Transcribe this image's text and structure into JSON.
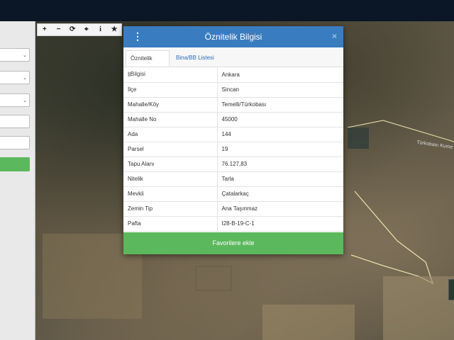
{
  "map": {
    "road_label": "Türkobası Kume Ev"
  },
  "toolbar": {
    "icons": [
      "plus-icon",
      "minus-icon",
      "refresh-icon",
      "crosshair-icon",
      "info-icon",
      "star-icon"
    ]
  },
  "modal": {
    "title": "Öznitelik Bilgisi",
    "close_label": "×",
    "menu_icon": "⋮",
    "tabs": [
      {
        "label": "Öznitelik Bilgisi",
        "active": true
      },
      {
        "label": "Bina/BB Listesi",
        "active": false
      }
    ],
    "rows": [
      {
        "key": "İl",
        "value": "Ankara"
      },
      {
        "key": "İlçe",
        "value": "Sincan"
      },
      {
        "key": "Mahalle/Köy",
        "value": "Temelli/Türkobası"
      },
      {
        "key": "Mahalle No",
        "value": "45000"
      },
      {
        "key": "Ada",
        "value": "144"
      },
      {
        "key": "Parsel",
        "value": "19"
      },
      {
        "key": "Tapu Alanı",
        "value": "76.127,83"
      },
      {
        "key": "Nitelik",
        "value": "Tarla"
      },
      {
        "key": "Mevkii",
        "value": "Çatalarkaç"
      },
      {
        "key": "Zemin Tip",
        "value": "Ana Taşınmaz"
      },
      {
        "key": "Pafta",
        "value": "I28-B-19-C-1"
      }
    ],
    "favorite_button": "Favorilere ekle"
  },
  "colors": {
    "header": "#3a7cc0",
    "accent_green": "#5cb85c",
    "topbar": "#0b1626"
  }
}
